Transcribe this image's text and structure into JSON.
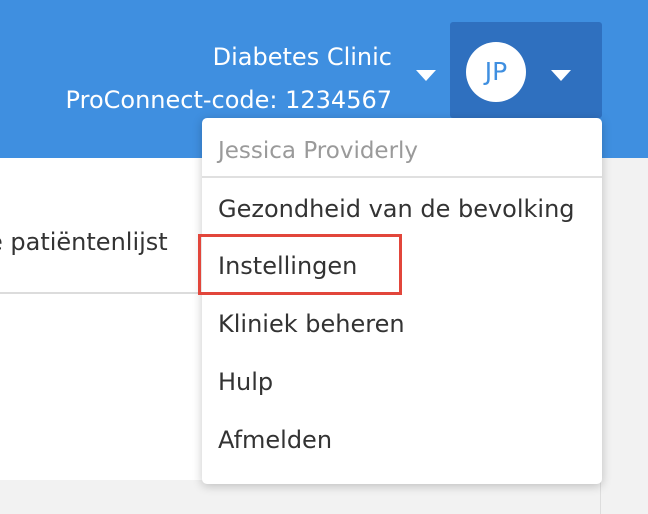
{
  "header": {
    "clinic_name": "Diabetes Clinic",
    "proconnect_code": "ProConnect-code: 1234567",
    "user_initials": "JP"
  },
  "content": {
    "tab_label": "e patiëntenlijst"
  },
  "user_menu": {
    "user_name": "Jessica Providerly",
    "items": [
      {
        "label": "Gezondheid van de bevolking"
      },
      {
        "label": "Instellingen"
      },
      {
        "label": "Kliniek beheren"
      },
      {
        "label": "Hulp"
      },
      {
        "label": "Afmelden"
      }
    ]
  },
  "colors": {
    "header_blue": "#3f8fe0",
    "user_button_blue": "#2f70bf",
    "highlight_red": "#e2463b"
  }
}
